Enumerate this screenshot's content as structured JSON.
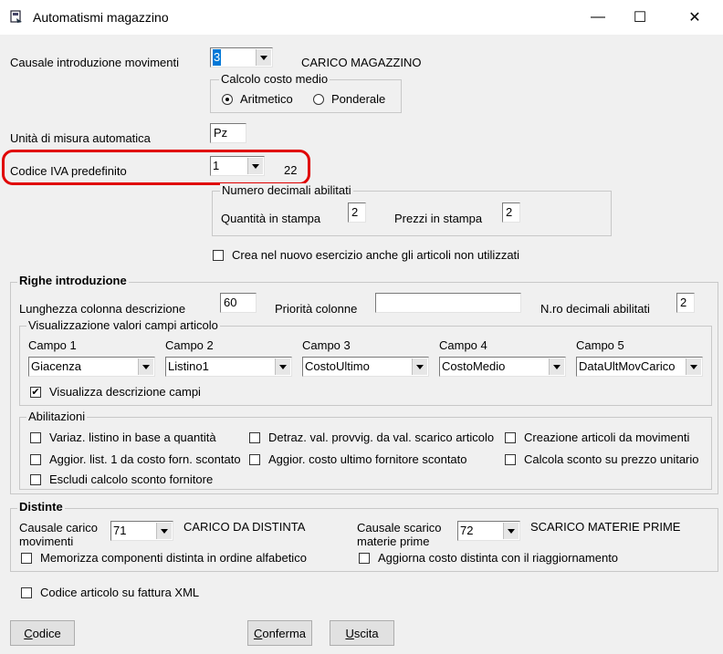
{
  "window": {
    "title": "Automatismi magazzino",
    "minimize": "—",
    "maximize": "☐",
    "close": "✕"
  },
  "causale": {
    "label": "Causale introduzione movimenti",
    "value": "3",
    "desc": "CARICO MAGAZZINO"
  },
  "costo_medio": {
    "title": "Calcolo costo medio",
    "aritmetico": "Aritmetico",
    "ponderale": "Ponderale",
    "selected": "aritmetico"
  },
  "unita_misura": {
    "label": "Unità di misura automatica",
    "value": "Pz"
  },
  "codice_iva": {
    "label": "Codice IVA predefinito",
    "value": "1",
    "rate": "22"
  },
  "decimali": {
    "title": "Numero decimali abilitati",
    "quantita_label": "Quantità in stampa",
    "quantita_value": "2",
    "prezzi_label": "Prezzi in stampa",
    "prezzi_value": "2"
  },
  "nuovo_esercizio": {
    "label": "Crea nel nuovo esercizio anche gli articoli non utilizzati",
    "checked": false
  },
  "righe": {
    "title": "Righe introduzione",
    "lunghezza_label": "Lunghezza colonna descrizione",
    "lunghezza_value": "60",
    "priorita_label": "Priorità colonne",
    "priorita_value": "",
    "nro_decimali_label": "N.ro decimali abilitati",
    "nro_decimali_value": "2"
  },
  "visualizzazione": {
    "title": "Visualizzazione valori campi articolo",
    "campi": [
      {
        "label": "Campo 1",
        "value": "Giacenza"
      },
      {
        "label": "Campo 2",
        "value": "Listino1"
      },
      {
        "label": "Campo 3",
        "value": "CostoUltimo"
      },
      {
        "label": "Campo 4",
        "value": "CostoMedio"
      },
      {
        "label": "Campo 5",
        "value": "DataUltMovCarico"
      }
    ],
    "descrizione_label": "Visualizza descrizione campi",
    "descrizione_checked": true
  },
  "abilitazioni": {
    "title": "Abilitazioni",
    "items": [
      {
        "label": "Variaz. listino in base a quantità",
        "checked": false
      },
      {
        "label": "Detraz. val. provvig. da val. scarico articolo",
        "checked": false
      },
      {
        "label": "Creazione articoli da movimenti",
        "checked": false
      },
      {
        "label": "Aggior. list. 1 da costo forn. scontato",
        "checked": false
      },
      {
        "label": "Aggior. costo ultimo fornitore scontato",
        "checked": false
      },
      {
        "label": "Calcola sconto su prezzo unitario",
        "checked": false
      },
      {
        "label": "Escludi calcolo sconto fornitore",
        "checked": false
      }
    ]
  },
  "distinte": {
    "title": "Distinte",
    "carico_label_1": "Causale carico",
    "carico_label_2": "movimenti",
    "carico_value": "71",
    "carico_desc": "CARICO DA DISTINTA",
    "scarico_label_1": "Causale scarico",
    "scarico_label_2": "materie prime",
    "scarico_value": "72",
    "scarico_desc": "SCARICO MATERIE PRIME",
    "memorizza_label": "Memorizza componenti distinta in ordine alfabetico",
    "aggiorna_label": "Aggiorna costo distinta con il riaggiornamento"
  },
  "codice_xml": {
    "label": "Codice articolo su fattura XML",
    "checked": false
  },
  "buttons": {
    "codice_ul": "C",
    "codice_rest": "odice",
    "conferma_ul": "C",
    "conferma_rest": "onferma",
    "uscita_ul": "U",
    "uscita_rest": "scita"
  },
  "colors": {
    "highlight": "#e00000",
    "dialog_bg": "#f0f0f0"
  }
}
